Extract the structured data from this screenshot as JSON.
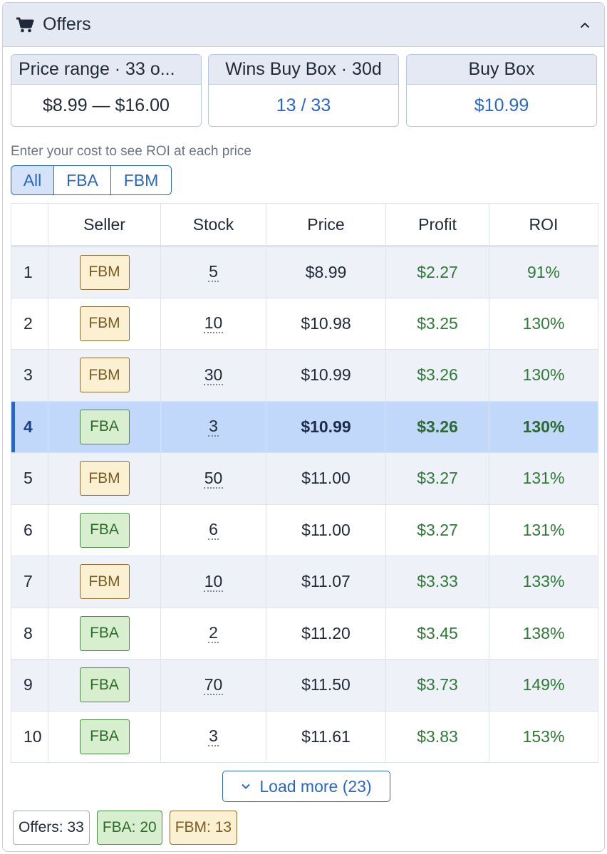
{
  "header": {
    "title": "Offers"
  },
  "stats": [
    {
      "label": "Price range · 33 o...",
      "value": "$8.99 — $16.00"
    },
    {
      "label": "Wins Buy Box · 30d",
      "value": "13 / 33"
    },
    {
      "label": "Buy Box",
      "value": "$10.99"
    }
  ],
  "hint": "Enter your cost to see ROI at each price",
  "filters": {
    "all": "All",
    "fba": "FBA",
    "fbm": "FBM",
    "active": "All"
  },
  "table": {
    "columns": [
      "",
      "Seller",
      "Stock",
      "Price",
      "Profit",
      "ROI"
    ],
    "rows": [
      {
        "rank": "1",
        "seller": "FBM",
        "stock": "5",
        "price": "$8.99",
        "profit": "$2.27",
        "roi": "91%"
      },
      {
        "rank": "2",
        "seller": "FBM",
        "stock": "10",
        "price": "$10.98",
        "profit": "$3.25",
        "roi": "130%"
      },
      {
        "rank": "3",
        "seller": "FBM",
        "stock": "30",
        "price": "$10.99",
        "profit": "$3.26",
        "roi": "130%"
      },
      {
        "rank": "4",
        "seller": "FBA",
        "stock": "3",
        "price": "$10.99",
        "profit": "$3.26",
        "roi": "130%"
      },
      {
        "rank": "5",
        "seller": "FBM",
        "stock": "50",
        "price": "$11.00",
        "profit": "$3.27",
        "roi": "131%"
      },
      {
        "rank": "6",
        "seller": "FBA",
        "stock": "6",
        "price": "$11.00",
        "profit": "$3.27",
        "roi": "131%"
      },
      {
        "rank": "7",
        "seller": "FBM",
        "stock": "10",
        "price": "$11.07",
        "profit": "$3.33",
        "roi": "133%"
      },
      {
        "rank": "8",
        "seller": "FBA",
        "stock": "2",
        "price": "$11.20",
        "profit": "$3.45",
        "roi": "138%"
      },
      {
        "rank": "9",
        "seller": "FBA",
        "stock": "70",
        "price": "$11.50",
        "profit": "$3.73",
        "roi": "149%"
      },
      {
        "rank": "10",
        "seller": "FBA",
        "stock": "3",
        "price": "$11.61",
        "profit": "$3.83",
        "roi": "153%"
      }
    ],
    "selected_rank": "4"
  },
  "load_more": "Load more (23)",
  "summary": {
    "offers": "Offers: 33",
    "fba": "FBA: 20",
    "fbm": "FBM: 13"
  },
  "colors": {
    "accent": "#2a66c4",
    "profit_green": "#2f7a36",
    "selected_row": "#c2d8fa",
    "fba_badge": "#d7eecf",
    "fbm_badge": "#fbf1d2"
  },
  "icons": {
    "header": "cart-icon",
    "collapse": "chevron-up-icon",
    "load_more": "chevron-down-icon"
  }
}
